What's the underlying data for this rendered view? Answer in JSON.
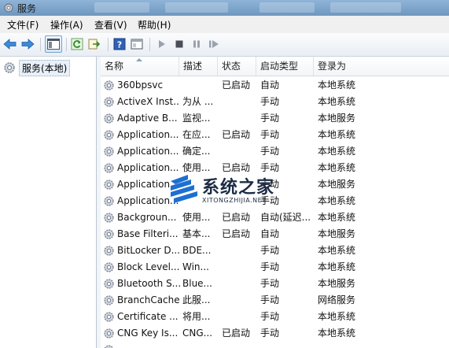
{
  "window": {
    "title": "服务"
  },
  "menu": [
    "文件(F)",
    "操作(A)",
    "查看(V)",
    "帮助(H)"
  ],
  "toolbar": {
    "buttons": [
      "back-arrow-icon",
      "forward-arrow-icon",
      "show-hide-tree-icon",
      "refresh-icon",
      "export-list-icon",
      "help-icon",
      "properties-icon",
      "start-icon",
      "stop-icon",
      "pause-icon",
      "restart-icon"
    ]
  },
  "tree": {
    "root_label": "服务(本地)"
  },
  "table": {
    "columns": [
      "名称",
      "描述",
      "状态",
      "启动类型",
      "登录为"
    ],
    "rows": [
      [
        "360bpsvc",
        "",
        "已启动",
        "自动",
        "本地系统"
      ],
      [
        "ActiveX Inst...",
        "为从 ...",
        "",
        "手动",
        "本地系统"
      ],
      [
        "Adaptive B...",
        "监视...",
        "",
        "手动",
        "本地服务"
      ],
      [
        "Application...",
        "在应...",
        "已启动",
        "手动",
        "本地系统"
      ],
      [
        "Application...",
        "确定...",
        "",
        "手动",
        "本地系统"
      ],
      [
        "Application...",
        "使用...",
        "已启动",
        "手动",
        "本地系统"
      ],
      [
        "Application...",
        "",
        "",
        "手动",
        "本地服务"
      ],
      [
        "Application...",
        "",
        "",
        "手动",
        "本地系统"
      ],
      [
        "Backgroun...",
        "使用...",
        "已启动",
        "自动(延迟...",
        "本地系统"
      ],
      [
        "Base Filteri...",
        "基本...",
        "已启动",
        "自动",
        "本地服务"
      ],
      [
        "BitLocker D...",
        "BDE...",
        "",
        "手动",
        "本地系统"
      ],
      [
        "Block Level...",
        "Win...",
        "",
        "手动",
        "本地系统"
      ],
      [
        "Bluetooth S...",
        "Blue...",
        "",
        "手动",
        "本地服务"
      ],
      [
        "BranchCache",
        "此服...",
        "",
        "手动",
        "网络服务"
      ],
      [
        "Certificate ...",
        "将用...",
        "",
        "手动",
        "本地系统"
      ],
      [
        "CNG Key Is...",
        "CNG...",
        "已启动",
        "手动",
        "本地系统"
      ],
      [
        "",
        "",
        "",
        "",
        ""
      ]
    ]
  },
  "watermark": {
    "name": "系统之家",
    "domain": "XITONGZHIJIA.NET"
  }
}
